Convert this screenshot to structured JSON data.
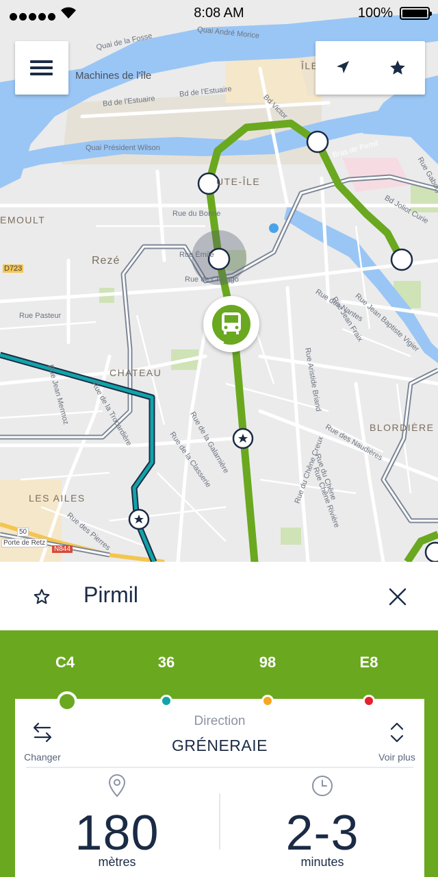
{
  "status_bar": {
    "time": "8:08 AM",
    "battery_percent_text": "100%",
    "battery_level": 1.0,
    "signal_bars": 5,
    "wifi_icon": "wifi-icon"
  },
  "map": {
    "labels": {
      "quai_fosse": "Quai de la Fosse",
      "quai_andre_morice": "Quai André Morice",
      "machines": "Machines de l'île",
      "ile": "ÎLE",
      "bd_estuaire_1": "Bd de l'Estuaire",
      "bd_estuaire_2": "Bd de l'Estuaire",
      "bd_victor": "Bd Victor",
      "quai_wilson": "Quai Président Wilson",
      "bras_pirmil": "Bras de Pirmil",
      "rue_gabory": "Rue Gabory",
      "trentemoult": "EMOULT",
      "rezé_ile": "UTE-ÎLE",
      "rue_bonne": "Rue du Bonne",
      "bd_joliot": "Bd Joliot Curie",
      "d723": "D723",
      "reze": "Rezé",
      "rue_emile": "Rue Émile",
      "rue_chicago": "Rue de Chicago",
      "rue_pasteur": "Rue Pasteur",
      "rue_nantes": "Rue des Nantes",
      "rue_jean_fraix": "Rue Jean Fraix",
      "rue_jean_baptiste": "Rue Jean Baptiste Vigier",
      "chateau": "CHATEAU",
      "rue_jean_mermoz": "Rue Jean Mermoz",
      "rue_trocardiere": "Rue de la Trocardière",
      "rue_aristide": "Rue Aristide Briand",
      "blordiere": "BLORDIÈRE",
      "rue_galarniere": "Rue de la Galarnière",
      "rue_classerie": "Rue de la Classerie",
      "rue_chene_creux": "Rue du Chêne Creux",
      "rue_naudieres": "Rue des Naudières",
      "rue_chene": "Rue du Chêne",
      "rue_chene_riviere": "Rue Chêne Rivière",
      "les_ailes": "LES AILES",
      "porte_retz": "Porte de Retz",
      "n844": "N844",
      "rte_50": "50",
      "rue_pierres": "Rue des Pierres"
    }
  },
  "menu_button": {
    "icon": "hamburger-menu-icon"
  },
  "locate_button": {
    "icon": "navigation-arrow-icon"
  },
  "favorites_button": {
    "icon": "star-icon"
  },
  "selected_stop": {
    "name": "Pirmil",
    "favorite_icon": "star-outline-icon",
    "close_icon": "close-icon"
  },
  "lines": [
    {
      "label": "C4",
      "color": "#6aa820",
      "selected": true
    },
    {
      "label": "36",
      "color": "#11a4a8",
      "selected": false
    },
    {
      "label": "98",
      "color": "#f5a623",
      "selected": false
    },
    {
      "label": "E8",
      "color": "#e5212e",
      "selected": false
    }
  ],
  "direction": {
    "label": "Direction",
    "value": "GRÉNERAIE",
    "changer_label": "Changer",
    "voir_plus_label": "Voir plus"
  },
  "distance": {
    "value": "180",
    "unit": "mètres",
    "icon": "location-pin-icon"
  },
  "wait_time": {
    "value": "2-3",
    "unit": "minutes",
    "icon": "clock-icon"
  },
  "colors": {
    "accent_green": "#6aa820",
    "line_teal": "#11a4a8",
    "navy": "#1b2b45",
    "water": "#9ac6f5"
  }
}
